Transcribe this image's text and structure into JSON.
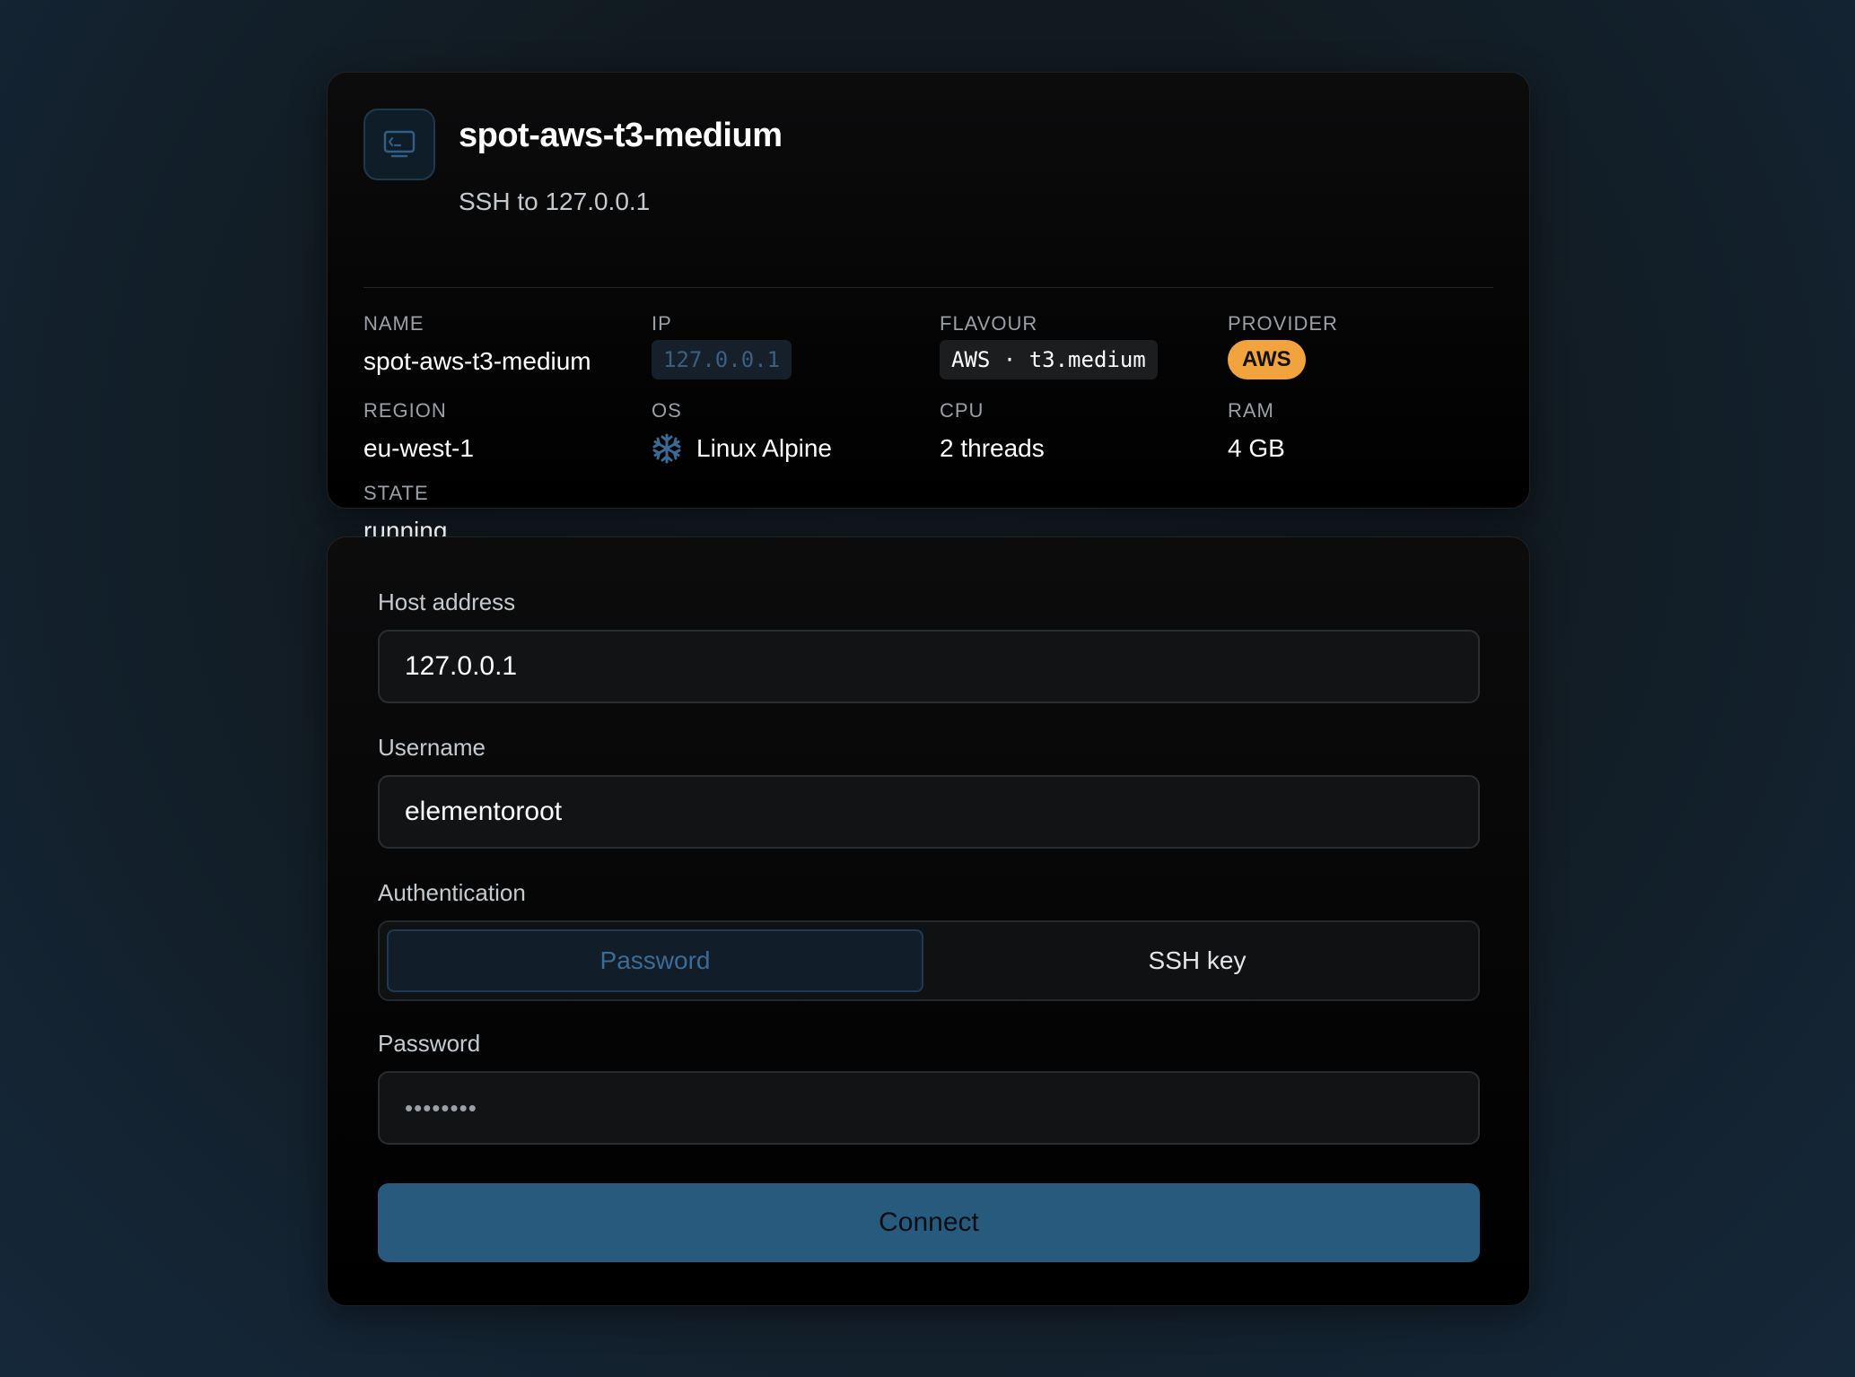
{
  "header": {
    "title": "spot-aws-t3-medium",
    "subtitle": "SSH to 127.0.0.1",
    "icon": "terminal-icon"
  },
  "details": {
    "name": {
      "label": "NAME",
      "value": "spot-aws-t3-medium"
    },
    "ip": {
      "label": "IP",
      "value": "127.0.0.1"
    },
    "flavour": {
      "label": "FLAVOUR",
      "value": "AWS · t3.medium"
    },
    "provider": {
      "label": "PROVIDER",
      "value": "AWS",
      "color": "#f3a33e"
    },
    "region": {
      "label": "REGION",
      "value": "eu-west-1"
    },
    "os": {
      "label": "OS",
      "value": "Linux Alpine",
      "icon": "snowflake-icon"
    },
    "cpu": {
      "label": "CPU",
      "value": "2 threads"
    },
    "ram": {
      "label": "RAM",
      "value": "4 GB"
    },
    "state": {
      "label": "STATE",
      "value": "running"
    }
  },
  "form": {
    "host_label": "Host address",
    "host_value": "127.0.0.1",
    "username_label": "Username",
    "username_value": "elementoroot",
    "auth_label": "Authentication",
    "auth_options": [
      "Password",
      "SSH key"
    ],
    "auth_selected": "Password",
    "password_label": "Password",
    "password_value": "••••••••",
    "connect_label": "Connect"
  },
  "colors": {
    "accent": "#285a7d",
    "accent_text": "#3c6c95",
    "provider_badge": "#f3a33e"
  }
}
